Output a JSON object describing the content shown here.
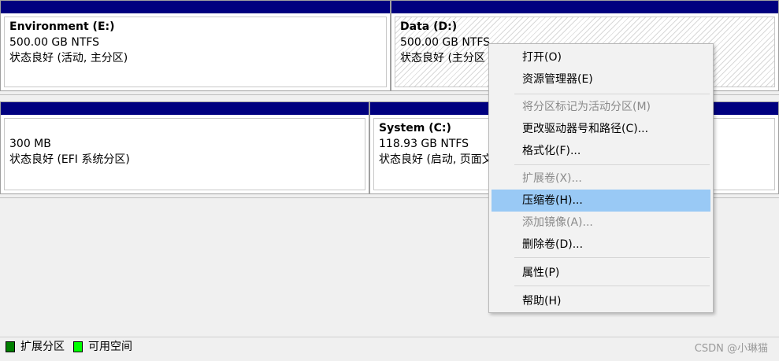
{
  "disk_top": {
    "partitions": [
      {
        "name": "Environment  (E:)",
        "size": "500.00 GB NTFS",
        "status": "状态良好 (活动, 主分区)"
      },
      {
        "name": "Data  (D:)",
        "size": "500.00 GB NTFS",
        "status": "状态良好 (主分区"
      }
    ]
  },
  "disk_bottom": {
    "partitions": [
      {
        "name": "",
        "size": "300 MB",
        "status": "状态良好 (EFI 系统分区)"
      },
      {
        "name": "System  (C:)",
        "size": "118.93 GB NTFS",
        "status": "状态良好 (启动, 页面文"
      }
    ]
  },
  "context_menu": {
    "items": [
      {
        "label": "打开(O)",
        "enabled": true
      },
      {
        "label": "资源管理器(E)",
        "enabled": true
      },
      {
        "label": "将分区标记为活动分区(M)",
        "enabled": false
      },
      {
        "label": "更改驱动器号和路径(C)...",
        "enabled": true
      },
      {
        "label": "格式化(F)...",
        "enabled": true
      },
      {
        "label": "扩展卷(X)...",
        "enabled": false
      },
      {
        "label": "压缩卷(H)...",
        "enabled": true,
        "highlighted": true
      },
      {
        "label": "添加镜像(A)...",
        "enabled": false
      },
      {
        "label": "删除卷(D)...",
        "enabled": true
      },
      {
        "label": "属性(P)",
        "enabled": true
      },
      {
        "label": "帮助(H)",
        "enabled": true
      }
    ]
  },
  "legend": {
    "items": [
      {
        "label": "扩展分区",
        "color": "#007f00"
      },
      {
        "label": "可用空间",
        "color": "#00ff00"
      }
    ]
  },
  "watermark": "CSDN @小琳猫",
  "colors": {
    "partition_bar": "#00007f",
    "menu_highlight": "#99c9f5",
    "disabled_text": "#8a8a8a"
  }
}
